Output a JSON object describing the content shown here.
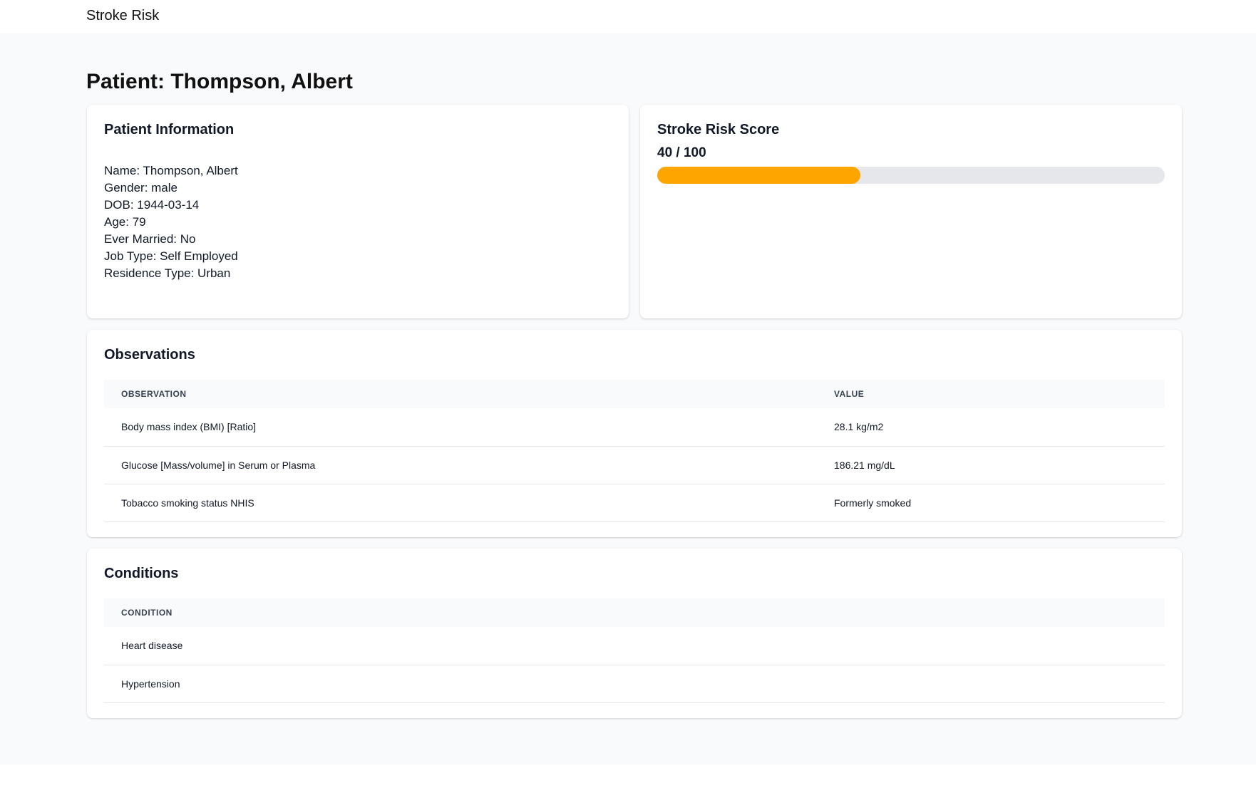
{
  "app": {
    "title": "Stroke Risk"
  },
  "page": {
    "title": "Patient: Thompson, Albert"
  },
  "patient_info": {
    "title": "Patient Information",
    "rows": [
      "Name: Thompson, Albert",
      "Gender: male",
      "DOB: 1944-03-14",
      "Age: 79",
      "Ever Married: No",
      "Job Type: Self Employed",
      "Residence Type: Urban"
    ]
  },
  "risk": {
    "title": "Stroke Risk Score",
    "score_text": "40 / 100",
    "score": 40,
    "max": 100,
    "bar_color": "#ffa500"
  },
  "observations": {
    "title": "Observations",
    "columns": [
      "OBSERVATION",
      "VALUE"
    ],
    "rows": [
      {
        "name": "Body mass index (BMI) [Ratio]",
        "value": "28.1 kg/m2"
      },
      {
        "name": "Glucose [Mass/volume] in Serum or Plasma",
        "value": "186.21 mg/dL"
      },
      {
        "name": "Tobacco smoking status NHIS",
        "value": "Formerly smoked"
      }
    ]
  },
  "conditions": {
    "title": "Conditions",
    "columns": [
      "CONDITION"
    ],
    "rows": [
      {
        "name": "Heart disease"
      },
      {
        "name": "Hypertension"
      }
    ]
  }
}
